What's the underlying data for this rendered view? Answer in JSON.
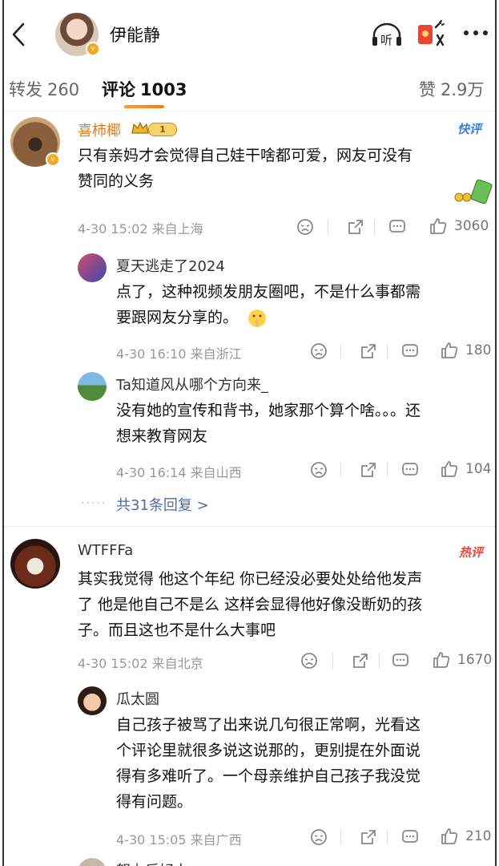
{
  "header": {
    "title": "伊能静",
    "listen_label": "听"
  },
  "tabs": {
    "repost_label": "转发",
    "repost_count": "260",
    "comment_label": "评论",
    "comment_count": "1003",
    "like_label": "赞",
    "like_count": "2.9万"
  },
  "comments": [
    {
      "user": "喜柿椰",
      "badge_level": "1",
      "tag": "快评",
      "text_lines": [
        "只有亲妈才会觉得自己娃干啥都可爱，网友可没有",
        "赞同的义务"
      ],
      "meta": "4-30 15:02 来自上海",
      "likes": "3060",
      "replies": [
        {
          "user": "夏天逃走了2024",
          "text_lines": [
            "点了，这种视频发朋友圈吧，不是什么事都需",
            "要跟网友分享的。"
          ],
          "meta": "4-30 16:10 来自浙江",
          "likes": "180"
        },
        {
          "user": "Ta知道风从哪个方向来_",
          "text_lines": [
            "没有她的宣传和背书，她家那个算个啥。。。还",
            "想来教育网友"
          ],
          "meta": "4-30 16:14 来自山西",
          "likes": "104"
        }
      ],
      "more_replies": "共31条回复 >"
    },
    {
      "user": "WTFFFa",
      "tag": "热评",
      "text_lines": [
        "其实我觉得 他这个年纪 你已经没必要处处给他发声",
        "了 他是他自己不是么 这样会显得他好像没断奶的孩",
        "子。而且这也不是什么大事吧"
      ],
      "meta": "4-30 15:02 来自北京",
      "likes": "1670",
      "replies": [
        {
          "user": "瓜太圆",
          "text_lines": [
            "自己孩子被骂了出来说几句很正常啊，光看这",
            "个评论里就很多说这说那的，更别提在外面说",
            "得有多难听了。一个母亲维护自己孩子我没觉",
            "得有问题。"
          ],
          "meta": "4-30 15:05 来自广西",
          "likes": "210"
        },
        {
          "user": "努力乐好人"
        }
      ]
    }
  ],
  "colors": {
    "accent": "#ff8200",
    "link": "#4a6ea9",
    "gold_name": "#e37c1c",
    "hot_red": "#e8483b",
    "quick_blue": "#3b7ddb"
  }
}
